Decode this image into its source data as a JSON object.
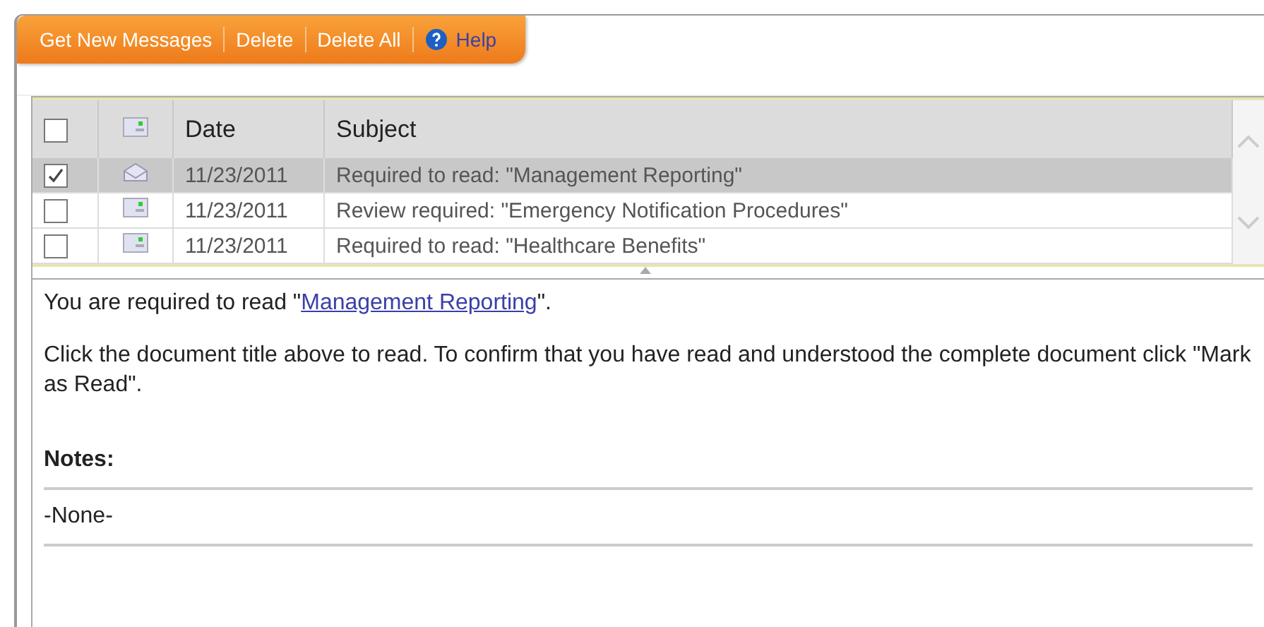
{
  "toolbar": {
    "buttons": [
      {
        "label": "Get New Messages",
        "kind": "plain"
      },
      {
        "label": "Delete",
        "kind": "plain"
      },
      {
        "label": "Delete All",
        "kind": "plain"
      },
      {
        "label": "Help",
        "kind": "help"
      }
    ]
  },
  "table": {
    "header_checkbox": {
      "checked": false
    },
    "columns": [
      "Date",
      "Subject"
    ],
    "rows": [
      {
        "checked": true,
        "selected": true,
        "read": true,
        "date": "11/23/2011",
        "subject": "Required to read: \"Management Reporting\""
      },
      {
        "checked": false,
        "selected": false,
        "read": false,
        "date": "11/23/2011",
        "subject": "Review required: \"Emergency Notification Procedures\""
      },
      {
        "checked": false,
        "selected": false,
        "read": false,
        "date": "11/23/2011",
        "subject": "Required to read: \"Healthcare Benefits\""
      }
    ]
  },
  "message": {
    "intro_before": "You are required to read \"",
    "intro_link": "Management Reporting",
    "intro_after": "\".",
    "instructions": "Click the document title above to read. To confirm that you have read and understood the complete document click \"Mark as Read\".",
    "notes_label": "Notes:",
    "notes": "-None-"
  }
}
